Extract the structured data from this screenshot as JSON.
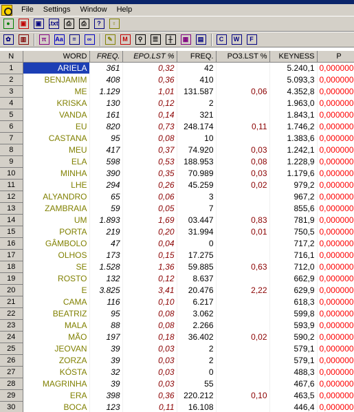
{
  "menu": {
    "items": [
      "File",
      "Settings",
      "Window",
      "Help"
    ]
  },
  "toolbar1": [
    {
      "name": "go-icon",
      "glyph": "●",
      "color": "#008000"
    },
    {
      "name": "save-icon",
      "glyph": "▣",
      "color": "#c00000"
    },
    {
      "name": "open-icon",
      "glyph": "▣",
      "color": "#000080"
    },
    {
      "name": "txt-icon",
      "glyph": ".txt",
      "color": "#000080"
    },
    {
      "name": "print-icon",
      "glyph": "⎙",
      "color": "#000000"
    },
    {
      "name": "print-preview-icon",
      "glyph": "⎙",
      "color": "#000000"
    },
    {
      "name": "help-icon",
      "glyph": "?",
      "color": "#000080"
    },
    {
      "name": "tip-icon",
      "glyph": "♀",
      "color": "#808000"
    }
  ],
  "toolbar2": [
    {
      "name": "settings-icon",
      "glyph": "✿",
      "color": "#000080"
    },
    {
      "name": "columns-icon",
      "glyph": "▥",
      "color": "#800000"
    },
    {
      "name": "pi-icon",
      "glyph": "π",
      "color": "#800080"
    },
    {
      "name": "font-icon",
      "glyph": "Aa",
      "color": "#0000c0"
    },
    {
      "name": "equals-icon",
      "glyph": "=",
      "color": "#000080"
    },
    {
      "name": "link-icon",
      "glyph": "∞",
      "color": "#0000c0"
    },
    {
      "name": "marker-icon",
      "glyph": "✎",
      "color": "#808000"
    },
    {
      "name": "m-icon",
      "glyph": "M",
      "color": "#c00000"
    },
    {
      "name": "search-icon",
      "glyph": "⚲",
      "color": "#000000"
    },
    {
      "name": "list-icon",
      "glyph": "☰",
      "color": "#000000"
    },
    {
      "name": "plot-icon",
      "glyph": "╫",
      "color": "#000000"
    },
    {
      "name": "chart-icon",
      "glyph": "▦",
      "color": "#800080"
    },
    {
      "name": "image-icon",
      "glyph": "▤",
      "color": "#000080"
    },
    {
      "name": "c-icon",
      "glyph": "C",
      "color": "#000080"
    },
    {
      "name": "w-icon",
      "glyph": "W",
      "color": "#000080"
    },
    {
      "name": "f-icon",
      "glyph": "F",
      "color": "#000080"
    }
  ],
  "columns": [
    "N",
    "WORD",
    "FREQ.",
    "EPO.LST %",
    "FREQ.",
    "PO3.LST %",
    "KEYNESS",
    "P"
  ],
  "rows": [
    [
      "1",
      "ARIELA",
      "361",
      "0,32",
      "42",
      "",
      "5.240,1",
      "0,000000"
    ],
    [
      "2",
      "BENJAMIM",
      "408",
      "0,36",
      "410",
      "",
      "5.093,3",
      "0,000000"
    ],
    [
      "3",
      "ME",
      "1.129",
      "1,01",
      "131.587",
      "0,06",
      "4.352,8",
      "0,000000"
    ],
    [
      "4",
      "KRISKA",
      "130",
      "0,12",
      "2",
      "",
      "1.963,0",
      "0,000000"
    ],
    [
      "5",
      "VANDA",
      "161",
      "0,14",
      "321",
      "",
      "1.843,1",
      "0,000000"
    ],
    [
      "6",
      "EU",
      "820",
      "0,73",
      "248.174",
      "0,11",
      "1.746,2",
      "0,000000"
    ],
    [
      "7",
      "CASTANA",
      "95",
      "0,08",
      "10",
      "",
      "1.383,6",
      "0,000000"
    ],
    [
      "8",
      "MEU",
      "417",
      "0,37",
      "74.920",
      "0,03",
      "1.242,1",
      "0,000000"
    ],
    [
      "9",
      "ELA",
      "598",
      "0,53",
      "188.953",
      "0,08",
      "1.228,9",
      "0,000000"
    ],
    [
      "10",
      "MINHA",
      "390",
      "0,35",
      "70.989",
      "0,03",
      "1.179,6",
      "0,000000"
    ],
    [
      "11",
      "LHE",
      "294",
      "0,26",
      "45.259",
      "0,02",
      "979,2",
      "0,000000"
    ],
    [
      "12",
      "ALYANDRO",
      "65",
      "0,06",
      "3",
      "",
      "967,2",
      "0,000000"
    ],
    [
      "13",
      "ZAMBRAIA",
      "59",
      "0,05",
      "7",
      "",
      "855,6",
      "0,000000"
    ],
    [
      "14",
      "UM",
      "1.893",
      "1,69",
      "03.447",
      "0,83",
      "781,9",
      "0,000000"
    ],
    [
      "15",
      "PORTA",
      "219",
      "0,20",
      "31.994",
      "0,01",
      "750,5",
      "0,000000"
    ],
    [
      "16",
      "GÂMBOLO",
      "47",
      "0,04",
      "0",
      "",
      "717,2",
      "0,000000"
    ],
    [
      "17",
      "OLHOS",
      "173",
      "0,15",
      "17.275",
      "",
      "716,1",
      "0,000000"
    ],
    [
      "18",
      "SE",
      "1.528",
      "1,36",
      "59.885",
      "0,63",
      "712,0",
      "0,000000"
    ],
    [
      "19",
      "ROSTO",
      "132",
      "0,12",
      "8.637",
      "",
      "662,9",
      "0,000000"
    ],
    [
      "20",
      "E",
      "3.825",
      "3,41",
      "20.476",
      "2,22",
      "629,9",
      "0,000000"
    ],
    [
      "21",
      "CAMA",
      "116",
      "0,10",
      "6.217",
      "",
      "618,3",
      "0,000000"
    ],
    [
      "22",
      "BEATRIZ",
      "95",
      "0,08",
      "3.062",
      "",
      "599,8",
      "0,000000"
    ],
    [
      "23",
      "MALA",
      "88",
      "0,08",
      "2.266",
      "",
      "593,9",
      "0,000000"
    ],
    [
      "24",
      "MÃO",
      "197",
      "0,18",
      "36.402",
      "0,02",
      "590,2",
      "0,000000"
    ],
    [
      "25",
      "JEOVAN",
      "39",
      "0,03",
      "2",
      "",
      "579,1",
      "0,000000"
    ],
    [
      "26",
      "ZORZA",
      "39",
      "0,03",
      "2",
      "",
      "579,1",
      "0,000000"
    ],
    [
      "27",
      "KÓSTA",
      "32",
      "0,03",
      "0",
      "",
      "488,3",
      "0,000000"
    ],
    [
      "28",
      "MAGRINHA",
      "39",
      "0,03",
      "55",
      "",
      "467,6",
      "0,000000"
    ],
    [
      "29",
      "ERA",
      "398",
      "0,36",
      "220.212",
      "0,10",
      "463,5",
      "0,000000"
    ],
    [
      "30",
      "BOCA",
      "123",
      "0,11",
      "16.108",
      "",
      "446,4",
      "0,000000"
    ]
  ]
}
